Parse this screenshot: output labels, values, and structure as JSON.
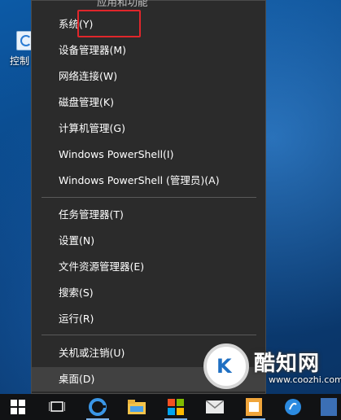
{
  "desktop": {
    "icon_label": "控制"
  },
  "menu": {
    "partial_top_label": "应用和功能",
    "items": [
      {
        "label": "系统(Y)"
      },
      {
        "label": "设备管理器(M)"
      },
      {
        "label": "网络连接(W)"
      },
      {
        "label": "磁盘管理(K)"
      },
      {
        "label": "计算机管理(G)"
      },
      {
        "label": "Windows PowerShell(I)"
      },
      {
        "label": "Windows PowerShell (管理员)(A)"
      },
      {
        "label": "任务管理器(T)"
      },
      {
        "label": "设置(N)"
      },
      {
        "label": "文件资源管理器(E)"
      },
      {
        "label": "搜索(S)"
      },
      {
        "label": "运行(R)"
      },
      {
        "label": "关机或注销(U)"
      },
      {
        "label": "桌面(D)"
      }
    ],
    "highlight_color": "#e0262b"
  },
  "watermark": {
    "name": "酷知网",
    "url": "www.coozhi.com"
  },
  "colors": {
    "menu_bg": "#2b2b2b",
    "taskbar_bg": "#111214",
    "accent": "#0a78d7"
  }
}
